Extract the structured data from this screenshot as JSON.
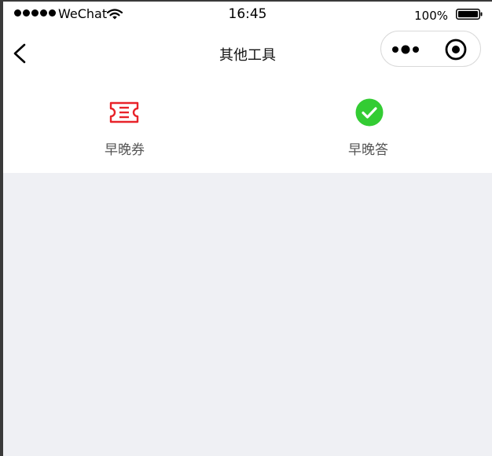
{
  "status_bar": {
    "carrier": "WeChat",
    "time": "16:45",
    "battery": "100%"
  },
  "nav": {
    "title": "其他工具"
  },
  "tools": [
    {
      "label": "早晚券",
      "icon": "ticket-icon",
      "color": "#e8232a"
    },
    {
      "label": "早晚答",
      "icon": "check-circle-icon",
      "color": "#33cc33"
    }
  ],
  "colors": {
    "background": "#eff0f4",
    "surface": "#ffffff"
  }
}
